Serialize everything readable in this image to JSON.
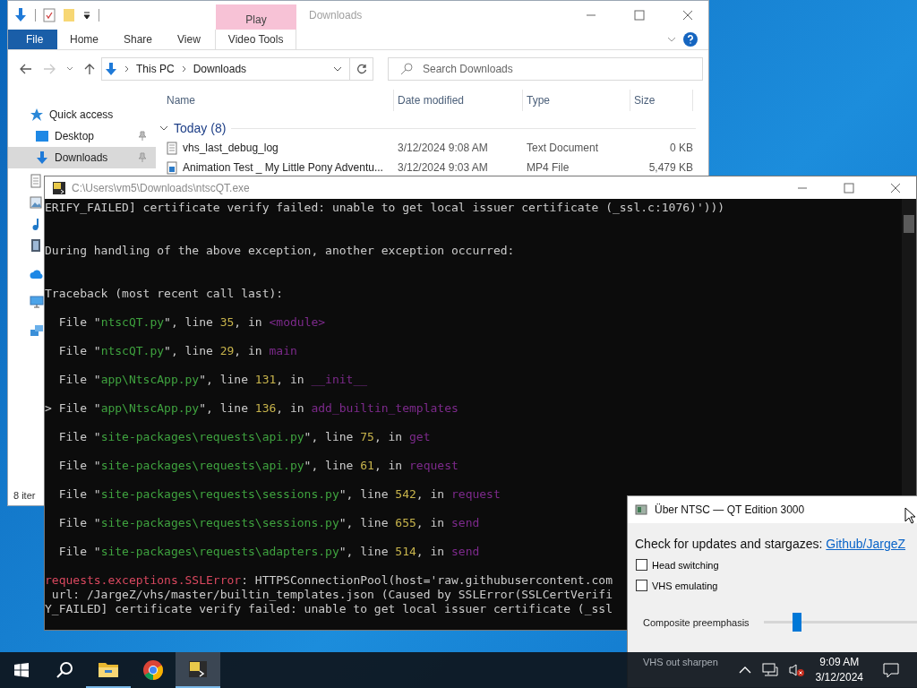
{
  "explorer": {
    "title": "Downloads",
    "context_label": "Play",
    "ribbon_tabs": [
      {
        "label": "File",
        "kind": "file"
      },
      {
        "label": "Home",
        "kind": "tab"
      },
      {
        "label": "Share",
        "kind": "tab"
      },
      {
        "label": "View",
        "kind": "tab"
      },
      {
        "label": "Video Tools",
        "kind": "contextual"
      }
    ],
    "crumbs": [
      "This PC",
      "Downloads"
    ],
    "search": {
      "placeholder": "Search Downloads"
    },
    "nav": [
      {
        "label": "Quick access",
        "kind": "star",
        "selected": false,
        "pinned": false
      },
      {
        "label": "Desktop",
        "kind": "desktop",
        "selected": false,
        "pinned": true
      },
      {
        "label": "Downloads",
        "kind": "download",
        "selected": true,
        "pinned": true
      }
    ],
    "columns": [
      "Name",
      "Date modified",
      "Type",
      "Size"
    ],
    "group": "Today (8)",
    "files": [
      {
        "name": "vhs_last_debug_log",
        "date": "3/12/2024 9:08 AM",
        "type": "Text Document",
        "size": "0 KB",
        "kind": "text"
      },
      {
        "name": "Animation Test _ My Little Pony Adventu...",
        "date": "3/12/2024 9:03 AM",
        "type": "MP4 File",
        "size": "5,479 KB",
        "kind": "video"
      }
    ],
    "status": "8 iter"
  },
  "console": {
    "title": "C:\\Users\\vm5\\Downloads\\ntscQT.exe",
    "lines": [
      {
        "kind": "text",
        "segments": [
          {
            "text": "ERIFY_FAILED] certificate verify failed: unable to get local issuer certificate (_ssl.c:1076)')))",
            "kind": "plain"
          }
        ]
      },
      {
        "kind": "blank"
      },
      {
        "kind": "blank"
      },
      {
        "kind": "text",
        "segments": [
          {
            "text": "During handling of the above exception, another exception occurred:",
            "kind": "plain"
          }
        ]
      },
      {
        "kind": "blank"
      },
      {
        "kind": "blank"
      },
      {
        "kind": "text",
        "segments": [
          {
            "text": "Traceback (most recent call last):",
            "kind": "plain"
          }
        ]
      },
      {
        "kind": "blank"
      },
      {
        "kind": "text",
        "segments": [
          {
            "text": "  File \"",
            "kind": "plain"
          },
          {
            "text": "ntscQT.py",
            "kind": "path"
          },
          {
            "text": "\", line ",
            "kind": "plain"
          },
          {
            "text": "35",
            "kind": "number"
          },
          {
            "text": ", in ",
            "kind": "plain"
          },
          {
            "text": "<module>",
            "kind": "name"
          }
        ]
      },
      {
        "kind": "blank"
      },
      {
        "kind": "text",
        "segments": [
          {
            "text": "  File \"",
            "kind": "plain"
          },
          {
            "text": "ntscQT.py",
            "kind": "path"
          },
          {
            "text": "\", line ",
            "kind": "plain"
          },
          {
            "text": "29",
            "kind": "number"
          },
          {
            "text": ", in ",
            "kind": "plain"
          },
          {
            "text": "main",
            "kind": "name"
          }
        ]
      },
      {
        "kind": "blank"
      },
      {
        "kind": "text",
        "segments": [
          {
            "text": "  File \"",
            "kind": "plain"
          },
          {
            "text": "app\\NtscApp.py",
            "kind": "path"
          },
          {
            "text": "\", line ",
            "kind": "plain"
          },
          {
            "text": "131",
            "kind": "number"
          },
          {
            "text": ", in ",
            "kind": "plain"
          },
          {
            "text": "__init__",
            "kind": "name"
          }
        ]
      },
      {
        "kind": "blank"
      },
      {
        "kind": "text",
        "segments": [
          {
            "text": "> File \"",
            "kind": "plain"
          },
          {
            "text": "app\\NtscApp.py",
            "kind": "path"
          },
          {
            "text": "\", line ",
            "kind": "plain"
          },
          {
            "text": "136",
            "kind": "number"
          },
          {
            "text": ", in ",
            "kind": "plain"
          },
          {
            "text": "add_builtin_templates",
            "kind": "name"
          }
        ]
      },
      {
        "kind": "blank"
      },
      {
        "kind": "text",
        "segments": [
          {
            "text": "  File \"",
            "kind": "plain"
          },
          {
            "text": "site-packages\\requests\\api.py",
            "kind": "path"
          },
          {
            "text": "\", line ",
            "kind": "plain"
          },
          {
            "text": "75",
            "kind": "number"
          },
          {
            "text": ", in ",
            "kind": "plain"
          },
          {
            "text": "get",
            "kind": "name"
          }
        ]
      },
      {
        "kind": "blank"
      },
      {
        "kind": "text",
        "segments": [
          {
            "text": "  File \"",
            "kind": "plain"
          },
          {
            "text": "site-packages\\requests\\api.py",
            "kind": "path"
          },
          {
            "text": "\", line ",
            "kind": "plain"
          },
          {
            "text": "61",
            "kind": "number"
          },
          {
            "text": ", in ",
            "kind": "plain"
          },
          {
            "text": "request",
            "kind": "name"
          }
        ]
      },
      {
        "kind": "blank"
      },
      {
        "kind": "text",
        "segments": [
          {
            "text": "  File \"",
            "kind": "plain"
          },
          {
            "text": "site-packages\\requests\\sessions.py",
            "kind": "path"
          },
          {
            "text": "\", line ",
            "kind": "plain"
          },
          {
            "text": "542",
            "kind": "number"
          },
          {
            "text": ", in ",
            "kind": "plain"
          },
          {
            "text": "request",
            "kind": "name"
          }
        ]
      },
      {
        "kind": "blank"
      },
      {
        "kind": "text",
        "segments": [
          {
            "text": "  File \"",
            "kind": "plain"
          },
          {
            "text": "site-packages\\requests\\sessions.py",
            "kind": "path"
          },
          {
            "text": "\", line ",
            "kind": "plain"
          },
          {
            "text": "655",
            "kind": "number"
          },
          {
            "text": ", in ",
            "kind": "plain"
          },
          {
            "text": "send",
            "kind": "name"
          }
        ]
      },
      {
        "kind": "blank"
      },
      {
        "kind": "text",
        "segments": [
          {
            "text": "  File \"",
            "kind": "plain"
          },
          {
            "text": "site-packages\\requests\\adapters.py",
            "kind": "path"
          },
          {
            "text": "\", line ",
            "kind": "plain"
          },
          {
            "text": "514",
            "kind": "number"
          },
          {
            "text": ", in ",
            "kind": "plain"
          },
          {
            "text": "send",
            "kind": "name"
          }
        ]
      },
      {
        "kind": "blank"
      },
      {
        "kind": "text",
        "segments": [
          {
            "text": "requests.exceptions.SSLError",
            "kind": "error"
          },
          {
            "text": ": HTTPSConnectionPool(host='raw.githubusercontent.com",
            "kind": "plain"
          }
        ]
      },
      {
        "kind": "text",
        "segments": [
          {
            "text": " url: /JargeZ/vhs/master/builtin_templates.json (Caused by SSLError(SSLCertVerifi",
            "kind": "plain"
          }
        ]
      },
      {
        "kind": "text",
        "segments": [
          {
            "text": "Y_FAILED] certificate verify failed: unable to get local issuer certificate (_ssl",
            "kind": "plain"
          }
        ]
      }
    ]
  },
  "dialog": {
    "title": "Über NTSC — QT Edition 3000",
    "intro": "Check for updates and stargazes:",
    "link": "Github/JargeZ",
    "checkboxes": [
      {
        "label": "Head switching",
        "checked": false
      },
      {
        "label": "VHS emulating",
        "checked": false
      }
    ],
    "sliders": [
      {
        "label": "Composite preemphasis",
        "level": 0.2
      }
    ],
    "next_label": "VHS out sharpen"
  },
  "taskbar": {
    "apps": [
      {
        "kind": "folder",
        "running": true,
        "active": false
      },
      {
        "kind": "browser",
        "running": false,
        "active": false
      },
      {
        "kind": "terminal",
        "running": true,
        "active": true
      }
    ],
    "time": "9:09 AM",
    "date": "3/12/2024"
  }
}
